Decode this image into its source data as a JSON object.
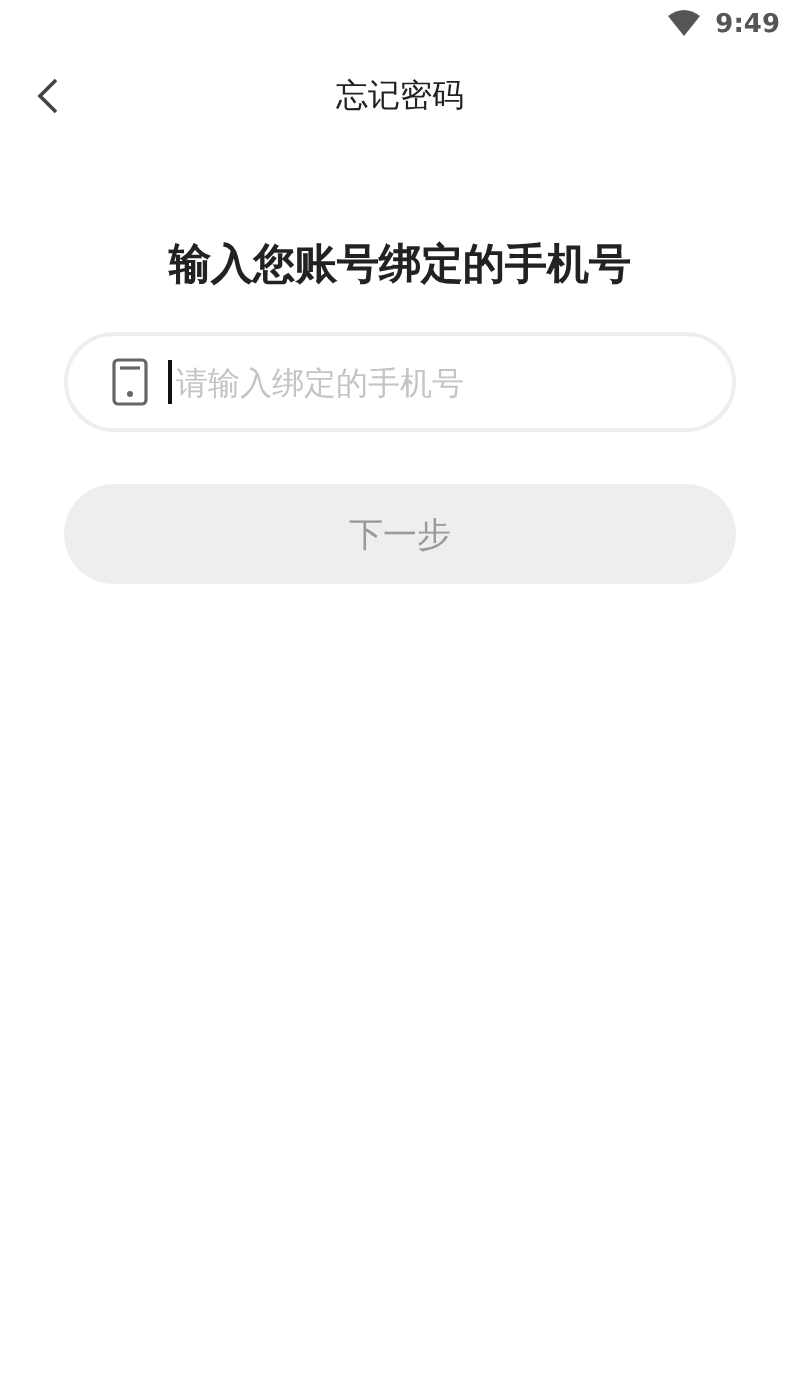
{
  "status_bar": {
    "time": "9:49"
  },
  "header": {
    "title": "忘记密码"
  },
  "heading": "输入您账号绑定的手机号",
  "phone_field": {
    "placeholder": "请输入绑定的手机号"
  },
  "next_button": {
    "label": "下一步",
    "disabled": true
  }
}
